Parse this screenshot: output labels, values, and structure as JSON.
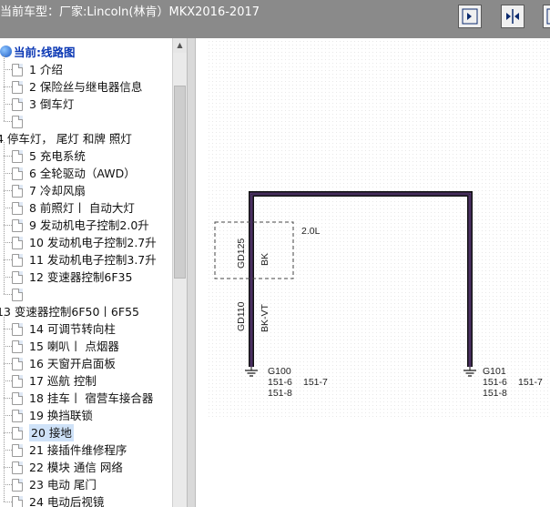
{
  "header": {
    "title": "当前车型：厂家:Lincoln(林肯）MKX2016-2017"
  },
  "toolbar": {
    "buttons": [
      {
        "icon": "fit-page-icon"
      },
      {
        "icon": "fit-width-icon"
      },
      {
        "icon": "zoom-window-icon"
      }
    ]
  },
  "sidebar": {
    "root_label": "当前:线路图",
    "items": [
      {
        "label": "1 介绍"
      },
      {
        "label": "2 保险丝与继电器信息"
      },
      {
        "label": "3 倒车灯"
      },
      {
        "label": ""
      },
      {
        "label": "4 停车灯， 尾灯 和牌 照灯"
      },
      {
        "label": "5 充电系统"
      },
      {
        "label": "6 全轮驱动（AWD）"
      },
      {
        "label": "7 冷却风扇"
      },
      {
        "label": "8 前照灯丨 自动大灯"
      },
      {
        "label": "9 发动机电子控制2.0升"
      },
      {
        "label": "10 发动机电子控制2.7升"
      },
      {
        "label": "11 发动机电子控制3.7升"
      },
      {
        "label": "12 变速器控制6F35"
      },
      {
        "label": ""
      },
      {
        "label": "13 变速器控制6F50丨6F55"
      },
      {
        "label": "14 可调节转向柱"
      },
      {
        "label": "15 喇叭丨 点烟器"
      },
      {
        "label": "16 天窗开启面板"
      },
      {
        "label": "17 巡航 控制"
      },
      {
        "label": "18 挂车丨 宿营车接合器"
      },
      {
        "label": "19 换挡联锁"
      },
      {
        "label": "20 接地"
      },
      {
        "label": "21 接插件维修程序"
      },
      {
        "label": "22 模块 通信 网络"
      },
      {
        "label": "23 电动 尾门"
      },
      {
        "label": "24 电动后视镜"
      }
    ],
    "selected_index": 21
  },
  "diagram": {
    "engine_label": "2.0L",
    "wire_upper_circuit": "GD125",
    "wire_upper_color": "BK",
    "wire_lower_circuit": "GD110",
    "wire_lower_color": "BK-VT",
    "ground_left": {
      "name": "G100",
      "refs": [
        "151-6",
        "151-7",
        "151-8"
      ]
    },
    "ground_right": {
      "name": "G101",
      "refs": [
        "151-6",
        "151-7",
        "151-8"
      ]
    }
  }
}
